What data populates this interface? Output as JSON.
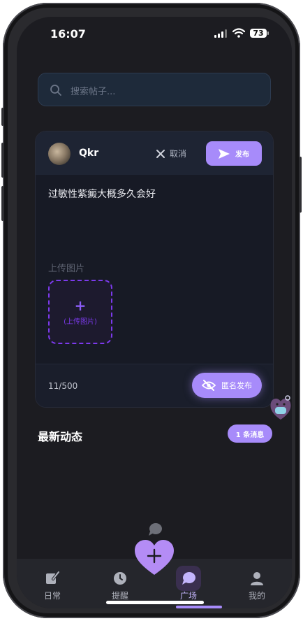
{
  "status_bar": {
    "time": "16:07",
    "battery": "73"
  },
  "search": {
    "placeholder": "搜索帖子..."
  },
  "composer": {
    "username": "Qkr",
    "cancel_label": "取消",
    "publish_label": "发布",
    "content": "过敏性紫癜大概多久会好",
    "upload_section_label": "上传图片",
    "upload_box_label": "(上传图片)",
    "char_count": "11/500",
    "anonymous_publish_label": "匿名发布"
  },
  "feed": {
    "section_title": "最新动态",
    "message_badge": "1 条消息"
  },
  "tabbar": {
    "items": [
      {
        "label": "日常",
        "icon": "edit-note-icon"
      },
      {
        "label": "提醒",
        "icon": "clock-icon"
      },
      {
        "label": "广场",
        "icon": "chat-bubble-icon",
        "active": true
      },
      {
        "label": "我的",
        "icon": "person-icon"
      }
    ]
  },
  "colors": {
    "accent": "#a78bfa",
    "background": "#1c1c21",
    "dashed_border": "#7c3aed"
  }
}
